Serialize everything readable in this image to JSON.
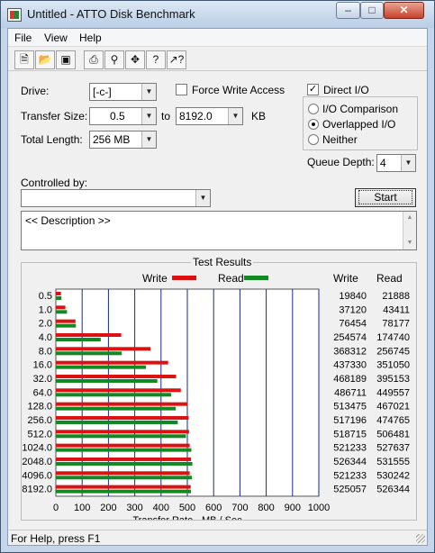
{
  "window": {
    "title": "Untitled - ATTO Disk Benchmark"
  },
  "menu": {
    "file": "File",
    "view": "View",
    "help": "Help"
  },
  "toolbar": {
    "icons": [
      "new-document-icon",
      "open-folder-icon",
      "save-icon",
      "print-icon",
      "print-preview-icon",
      "move-icon",
      "help-icon",
      "context-help-icon"
    ]
  },
  "form": {
    "drive_label": "Drive:",
    "drive_value": "[-c-]",
    "force_write_label": "Force Write Access",
    "force_write_checked": false,
    "direct_io_label": "Direct I/O",
    "direct_io_checked": true,
    "transfer_size_label": "Transfer Size:",
    "transfer_from": "0.5",
    "to_label": "to",
    "transfer_to": "8192.0",
    "kb_label": "KB",
    "total_length_label": "Total Length:",
    "total_length_value": "256 MB",
    "io_comparison_label": "I/O Comparison",
    "overlapped_io_label": "Overlapped I/O",
    "neither_label": "Neither",
    "selected_mode": "Overlapped I/O",
    "queue_depth_label": "Queue Depth:",
    "queue_depth_value": "4",
    "controlled_by_label": "Controlled by:",
    "controlled_by_value": "",
    "start_label": "Start",
    "description_text": "<< Description >>"
  },
  "results": {
    "title": "Test Results",
    "write_legend": "Write",
    "read_legend": "Read",
    "write_col_header": "Write",
    "read_col_header": "Read",
    "write_color": "#dd1111",
    "read_color": "#118822"
  },
  "chart_data": {
    "type": "bar",
    "orientation": "horizontal",
    "categories": [
      "0.5",
      "1.0",
      "2.0",
      "4.0",
      "8.0",
      "16.0",
      "32.0",
      "64.0",
      "128.0",
      "256.0",
      "512.0",
      "1024.0",
      "2048.0",
      "4096.0",
      "8192.0"
    ],
    "series": [
      {
        "name": "Write",
        "values": [
          19840,
          37120,
          76454,
          254574,
          368312,
          437330,
          468189,
          486711,
          513475,
          517196,
          518715,
          521233,
          526344,
          521233,
          525057
        ]
      },
      {
        "name": "Read",
        "values": [
          21888,
          43411,
          78177,
          174740,
          256745,
          351050,
          395153,
          449557,
          467021,
          474765,
          506481,
          527637,
          531555,
          530242,
          526344
        ]
      }
    ],
    "xlabel": "Transfer Rate - MB / Sec",
    "xticks": [
      "0",
      "100",
      "200",
      "300",
      "400",
      "500",
      "600",
      "700",
      "800",
      "900",
      "1000"
    ],
    "xlim": [
      0,
      1000
    ],
    "value_units": "KB/s"
  },
  "status": {
    "text": "For Help, press F1"
  }
}
